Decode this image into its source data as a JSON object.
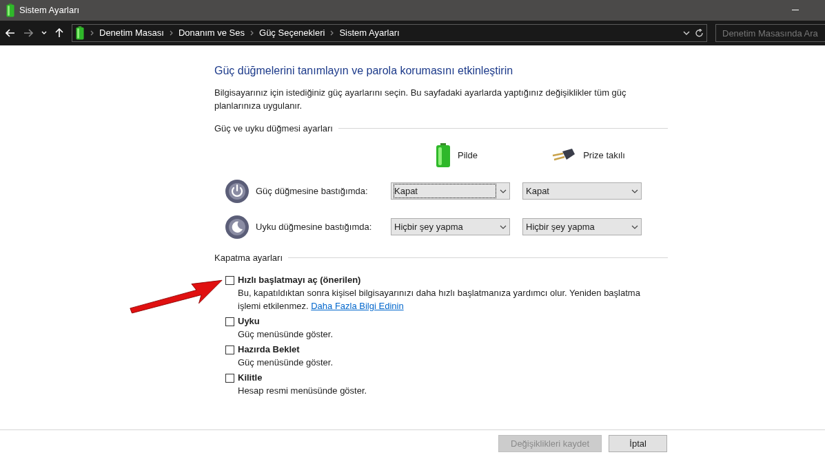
{
  "window": {
    "title": "Sistem Ayarları"
  },
  "address_bar": {
    "breadcrumb": [
      "Denetim Masası",
      "Donanım ve Ses",
      "Güç Seçenekleri",
      "Sistem Ayarları"
    ],
    "search": {
      "placeholder": "Denetim Masasında Ara"
    }
  },
  "heading": "Güç düğmelerini tanımlayın ve parola korumasını etkinleştirin",
  "intro": "Bilgisayarınız için istediğiniz güç ayarlarını seçin. Bu sayfadaki ayarlarda yaptığınız değişiklikler tüm güç planlarınıza uygulanır.",
  "button_settings": {
    "title": "Güç ve uyku düğmesi ayarları",
    "columns": [
      {
        "kind": "battery",
        "label": "Pilde"
      },
      {
        "kind": "plug",
        "label": "Prize takılı"
      }
    ],
    "rows": [
      {
        "kind": "power",
        "label": "Güç düğmesine bastığımda:",
        "values": [
          {
            "value": "Kapat",
            "focused": true
          },
          {
            "value": "Kapat",
            "focused": false
          }
        ]
      },
      {
        "kind": "sleep",
        "label": "Uyku düğmesine bastığımda:",
        "values": [
          {
            "value": "Hiçbir şey yapma",
            "focused": false
          },
          {
            "value": "Hiçbir şey yapma",
            "focused": false
          }
        ]
      }
    ]
  },
  "shutdown_settings": {
    "title": "Kapatma ayarları",
    "options": [
      {
        "label": "Hızlı başlatmayı aç (önerilen)",
        "checked": false,
        "description": "Bu, kapatıldıktan sonra kişisel bilgisayarınızı daha hızlı başlatmanıza yardımcı olur. Yeniden başlatma işlemi etkilenmez.",
        "link": "Daha Fazla Bilgi Edinin"
      },
      {
        "label": "Uyku",
        "checked": false,
        "description": "Güç menüsünde göster."
      },
      {
        "label": "Hazırda Beklet",
        "checked": false,
        "description": "Güç menüsünde göster."
      },
      {
        "label": "Kilitle",
        "checked": false,
        "description": "Hesap resmi menüsünde göster."
      }
    ]
  },
  "buttons": [
    {
      "label": "Değişiklikleri kaydet",
      "disabled": true
    },
    {
      "label": "İptal",
      "disabled": false
    }
  ]
}
